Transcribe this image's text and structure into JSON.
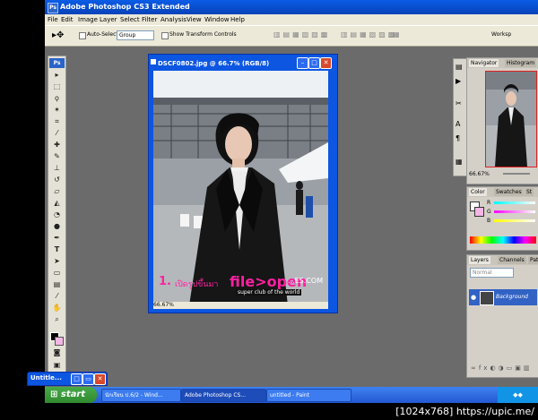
{
  "app": {
    "title": "Adobe Photoshop CS3 Extended",
    "logo": "Ps"
  },
  "menu": [
    "File",
    "Edit",
    "Image",
    "Layer",
    "Select",
    "Filter",
    "Analysis",
    "View",
    "Window",
    "Help"
  ],
  "options": {
    "auto_select_label": "Auto-Select:",
    "auto_select_value": "Group",
    "show_transform_label": "Show Transform Controls",
    "workspace_label": "Worksp"
  },
  "document": {
    "title": "DSCF0802.jpg @ 66.7% (RGB/8)",
    "zoom": "66.67%",
    "overlay_number": "1.",
    "overlay_thai": "เปิดรูปขึ้นมา",
    "overlay_command": "file>open",
    "watermark_line1": "...ES.COM",
    "watermark_line2": "super club of the world"
  },
  "navigator": {
    "tabs": [
      "Navigator",
      "Histogram"
    ],
    "zoom": "66.67%"
  },
  "color_panel": {
    "tabs": [
      "Color",
      "Swatches",
      "St"
    ],
    "channels": [
      "R",
      "G",
      "B"
    ]
  },
  "layers_panel": {
    "tabs": [
      "Layers",
      "Channels",
      "Pat"
    ],
    "blend_mode": "Normal",
    "layer_name": "Background"
  },
  "minimized_window": {
    "title": "Untitle..."
  },
  "taskbar": {
    "start_label": "start",
    "items": [
      "นักเรียน ป.6/2 - Wind...",
      "Adobe Photoshop CS...",
      "untitled - Paint"
    ],
    "tray_time": "",
    "tray_icons": "◆◆"
  },
  "resolution_label": "[1024x768] https://upic.me/",
  "colors": {
    "title_blue": "#0a5ce6",
    "workspace_gray": "#6b6b6b",
    "overlay_pink": "#ff1fa0",
    "start_green": "#3a9b3a"
  }
}
